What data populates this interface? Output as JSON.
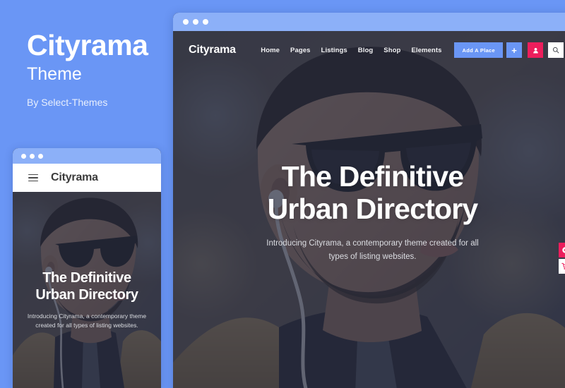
{
  "promo": {
    "title": "Cityrama",
    "subtitle": "Theme",
    "byline": "By Select-Themes"
  },
  "colors": {
    "page_background": "#6a96f5",
    "titlebar": "#8cb0f8",
    "accent_blue": "#6a96f5",
    "accent_pink": "#ec1e5c",
    "hero_overlay": "#2b2f3d"
  },
  "desktop": {
    "window_dots": [
      "dot-1",
      "dot-2",
      "dot-3"
    ],
    "site": {
      "logo": "Cityrama",
      "nav_links": [
        {
          "label": "Home"
        },
        {
          "label": "Pages"
        },
        {
          "label": "Listings"
        },
        {
          "label": "Blog"
        },
        {
          "label": "Shop"
        },
        {
          "label": "Elements"
        }
      ],
      "actions": {
        "add_place_label": "Add A Place",
        "plus_label": "+",
        "user_icon": "user-icon",
        "search_icon": "search-icon"
      },
      "hero": {
        "title_line1": "The Definitive",
        "title_line2": "Urban Directory",
        "subtitle": "Introducing Cityrama, a contemporary theme created for all types of listing websites."
      },
      "side_tabs": [
        {
          "icon": "settings-icon",
          "style": "pink"
        },
        {
          "icon": "cart-icon",
          "style": "white"
        }
      ]
    }
  },
  "mobile": {
    "window_dots": [
      "dot-1",
      "dot-2",
      "dot-3"
    ],
    "site": {
      "menu_icon": "hamburger-menu-icon",
      "logo": "Cityrama",
      "hero": {
        "title_line1": "The Definitive",
        "title_line2": "Urban Directory",
        "subtitle": "Introducing Cityrama, a contemporary theme created for all types of listing websites."
      }
    }
  }
}
